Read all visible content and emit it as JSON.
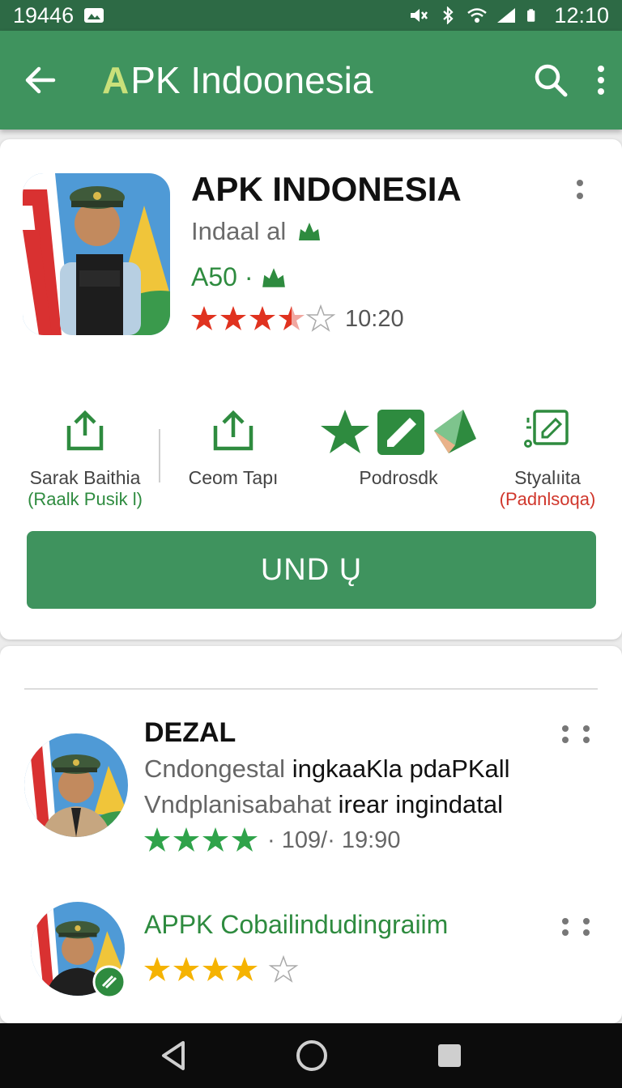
{
  "status_bar": {
    "left_text": "19446",
    "time": "12:10"
  },
  "app_bar": {
    "logo_mark": "A",
    "title": "PK Indoonesia"
  },
  "app": {
    "name": "APK INDONESIA",
    "developer": "Indaal al",
    "price": "A50 ·",
    "rating_stars": 3.5,
    "rating_text": "10:20"
  },
  "features": [
    {
      "icon": "share-icon",
      "label": "Sarak Baithia",
      "sub": "(Raalk Pusik l)",
      "sub_color": "#2e8b3f"
    },
    {
      "icon": "upload-icon",
      "label": "Ceom Tapı",
      "sub": "",
      "sub_color": ""
    },
    {
      "icon": "star-pencil-icon",
      "label": "Podrosdk",
      "sub": "",
      "sub_color": ""
    },
    {
      "icon": "edit-icon",
      "label": "Styalıita",
      "sub": "(Padnlsoqa)",
      "sub_color": "#d0362b"
    }
  ],
  "primary_button": {
    "label": "UND Ų"
  },
  "reviews": [
    {
      "title": "DEZAL",
      "line1_muted": "Cndongestal",
      "line1_bold": "ingkaaKla pdaPKall",
      "line2_muted": "Vndplanisabahat",
      "line2_bold": "irear ingindatal",
      "stars": 4,
      "meta_text": "· 109/· 19:90"
    },
    {
      "title": "APPK Cobailindudingraiim",
      "stars": 4
    }
  ],
  "colors": {
    "primary": "#3f935e",
    "status_bar": "#2d6a45",
    "star_red": "#e0321f",
    "star_green": "#2fa34a",
    "star_yellow": "#f5b301"
  }
}
